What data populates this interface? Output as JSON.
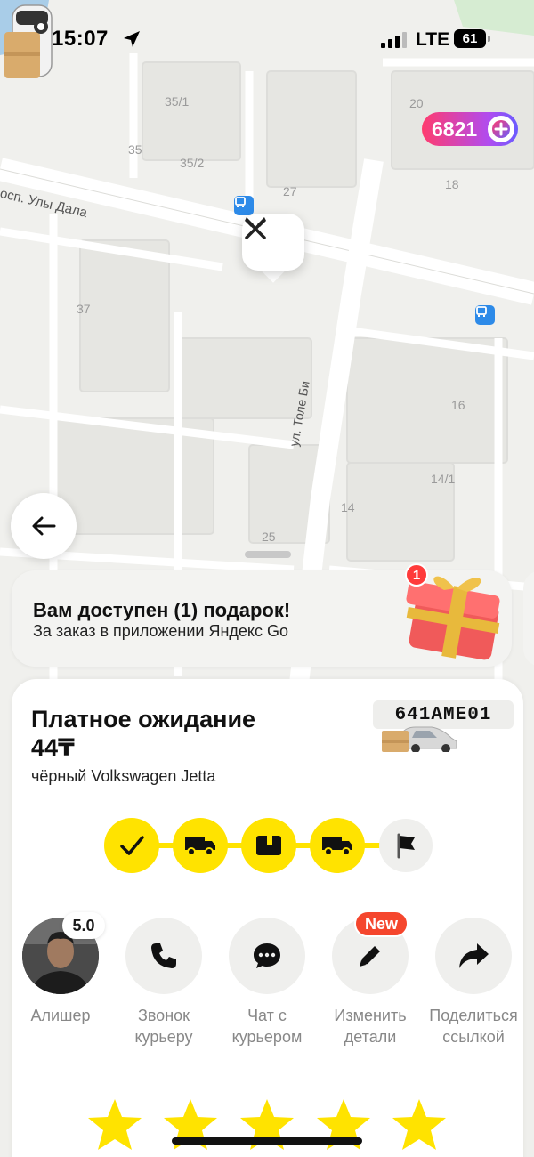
{
  "status_bar": {
    "time": "15:07",
    "network": "LTE",
    "battery": "61"
  },
  "plus_badge": {
    "points": "6821"
  },
  "map": {
    "street_1": "росп. Улы Дала",
    "street_2": "ул. Толе Би",
    "house_numbers": [
      "35/1",
      "35",
      "35/2",
      "27",
      "20",
      "18",
      "37",
      "16",
      "14/1",
      "14",
      "25"
    ]
  },
  "gift_banner": {
    "title": "Вам доступен (1) подарок!",
    "subtitle": "За заказ в приложении Яндекс Go",
    "count": "1"
  },
  "order": {
    "title": "Платное ожидание",
    "price": "44₸",
    "car": "чёрный Volkswagen Jetta",
    "plate": "641AME01",
    "progress_steps": [
      {
        "icon": "check-icon",
        "state": "done"
      },
      {
        "icon": "truck-icon",
        "state": "done"
      },
      {
        "icon": "package-icon",
        "state": "done"
      },
      {
        "icon": "truck-icon",
        "state": "current"
      },
      {
        "icon": "flag-icon",
        "state": "pending"
      }
    ]
  },
  "courier": {
    "name": "Алишер",
    "rating": "5.0"
  },
  "actions": {
    "call": "Звонок курьеру",
    "chat": "Чат с курьером",
    "edit": "Изменить детали",
    "edit_badge": "New",
    "share": "Поделиться ссылкой"
  },
  "rating_stars": {
    "count": 5,
    "color": "#ffe300"
  },
  "colors": {
    "accent_yellow": "#ffe300",
    "badge_red": "#f5462d",
    "bus_stop_blue": "#2d8ae8"
  }
}
